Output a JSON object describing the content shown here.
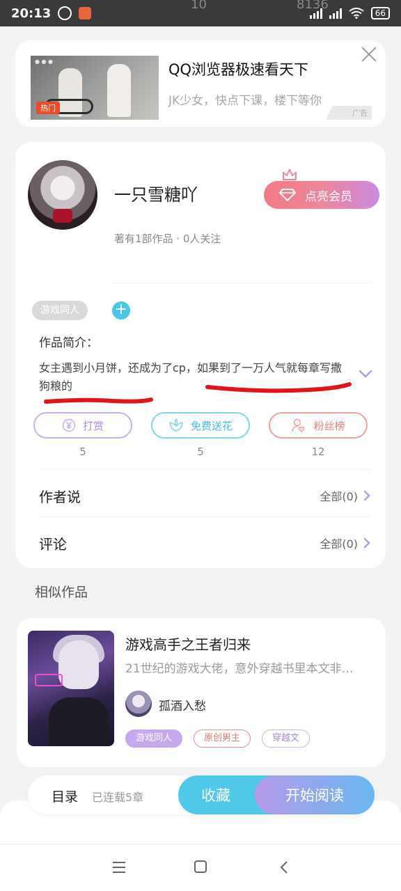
{
  "status_bar": {
    "time": "20:13",
    "behind_left": "10",
    "behind_right": "8136",
    "battery": "66"
  },
  "ad": {
    "title": "QQ浏览器极速看天下",
    "subtitle": "JK少女，快点下课，楼下等你",
    "badge": "广告",
    "hot_label": "热门"
  },
  "author": {
    "name": "一只雪糖吖",
    "stats": "著有1部作品 · 0人关注",
    "vip_button": "点亮会员"
  },
  "work": {
    "tag": "游戏同人",
    "add_tag": "+",
    "intro_label": "作品简介：",
    "intro_text": "女主遇到小月饼，还成为了cp，如果到了一万人气就每章写撒狗粮的"
  },
  "actions": [
    {
      "label": "打赏",
      "count": "5",
      "icon": "yuan-coin-icon"
    },
    {
      "label": "免费送花",
      "count": "5",
      "icon": "flower-icon"
    },
    {
      "label": "粉丝榜",
      "count": "12",
      "icon": "fan-user-icon"
    }
  ],
  "rows": [
    {
      "title": "作者说",
      "right": "全部(0)"
    },
    {
      "title": "评论",
      "right": "全部(0)"
    }
  ],
  "similar": {
    "section_title": "相似作品",
    "book": {
      "title": "游戏高手之王者归来",
      "desc": "21世纪的游戏大佬，意外穿越书里本文非…",
      "author": "孤酒入愁",
      "tags": [
        "游戏同人",
        "原创男主",
        "穿越文"
      ]
    }
  },
  "bottom_bar": {
    "toc": "目录",
    "serial": "已连载5章",
    "collect": "收藏",
    "read": "开始阅读"
  },
  "colors": {
    "accent_blue": "#4fc8ea",
    "vip_pink": "#f27a86",
    "purple": "#a88ae0",
    "scribble_red": "#e0141a"
  }
}
